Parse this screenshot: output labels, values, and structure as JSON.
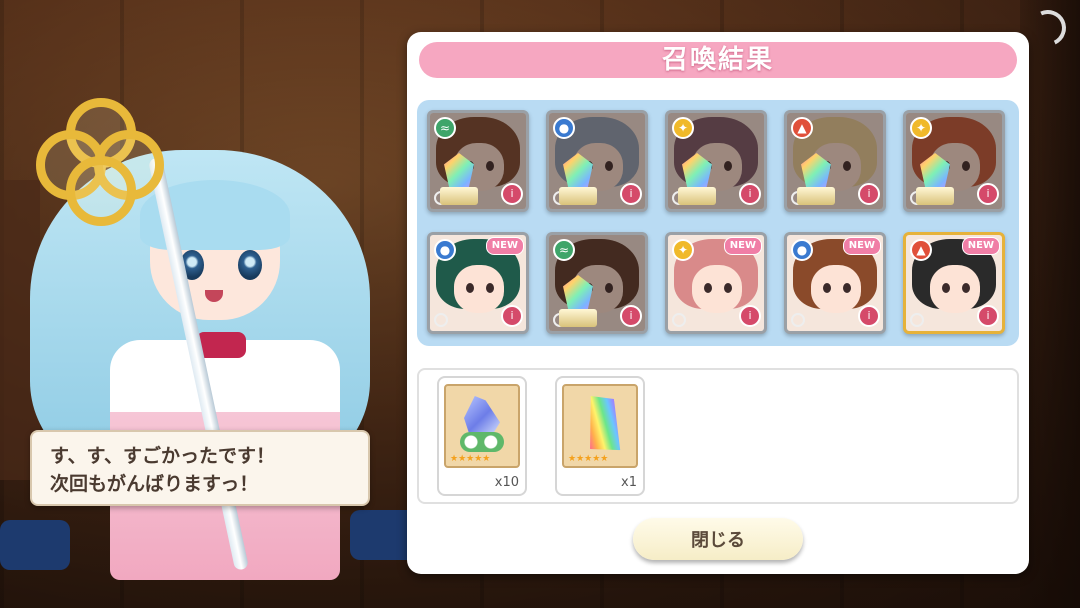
{
  "panel": {
    "title": "召喚結果",
    "close_label": "閉じる"
  },
  "speech": {
    "line1": "す、す、すごかったです！",
    "line2": "次回もがんばりますっ！"
  },
  "cards": [
    {
      "element": "wind",
      "element_color": "#3fa56a",
      "is_new": false,
      "converted": true,
      "hair": "#7a4a30"
    },
    {
      "element": "water",
      "element_color": "#3a7ad0",
      "is_new": false,
      "converted": true,
      "hair": "#8fa3b8"
    },
    {
      "element": "light",
      "element_color": "#f0b92a",
      "is_new": false,
      "converted": true,
      "hair": "#7a5a6a"
    },
    {
      "element": "fire",
      "element_color": "#e0503a",
      "is_new": false,
      "converted": true,
      "hair": "#e9d19a"
    },
    {
      "element": "light",
      "element_color": "#f0b92a",
      "is_new": false,
      "converted": true,
      "hair": "#c25a3a"
    },
    {
      "element": "water",
      "element_color": "#3a7ad0",
      "is_new": true,
      "converted": false,
      "hair": "#1f5a4a"
    },
    {
      "element": "wind",
      "element_color": "#3fa56a",
      "is_new": false,
      "converted": true,
      "hair": "#5a3a2a"
    },
    {
      "element": "light",
      "element_color": "#f0b92a",
      "is_new": true,
      "converted": false,
      "hair": "#d98a8a"
    },
    {
      "element": "water",
      "element_color": "#3a7ad0",
      "is_new": true,
      "converted": false,
      "hair": "#8a4a2a"
    },
    {
      "element": "fire",
      "element_color": "#e0503a",
      "is_new": true,
      "converted": false,
      "hair": "#2a2a2a",
      "gold_frame": true
    }
  ],
  "new_badge_label": "NEW",
  "items": [
    {
      "name": "crystal-flower",
      "quantity": "x10",
      "stars": "★★★★★"
    },
    {
      "name": "rainbow-shard",
      "quantity": "x1",
      "stars": "★★★★★"
    }
  ]
}
